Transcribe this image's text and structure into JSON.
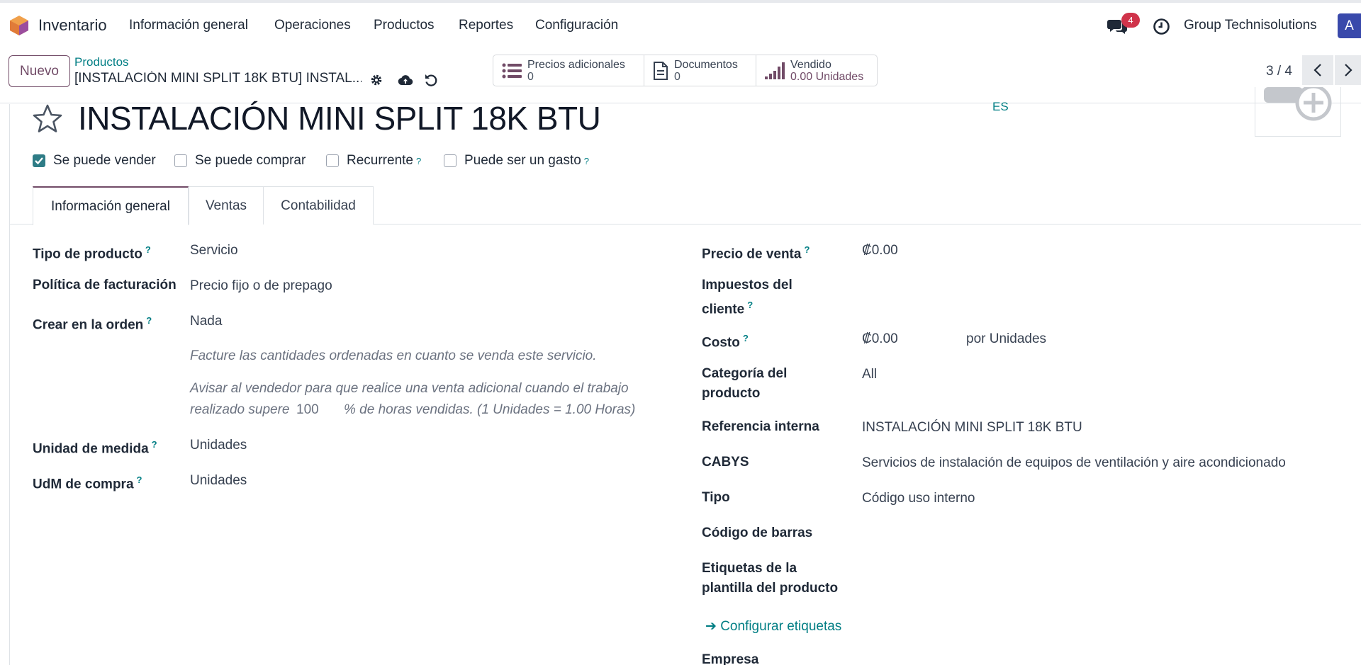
{
  "app": {
    "name": "Inventario"
  },
  "nav": {
    "menus": [
      "Información general",
      "Operaciones",
      "Productos",
      "Reportes",
      "Configuración"
    ],
    "chat_count": "4",
    "company": "Group Technisolutions",
    "avatar_letter": "A"
  },
  "control": {
    "new_label": "Nuevo",
    "breadcrumb_parent": "Productos",
    "breadcrumb_current": "[INSTALACIÓN MINI SPLIT 18K BTU] INSTAL...",
    "smart_buttons": [
      {
        "label": "Precios adicionales",
        "value": "0"
      },
      {
        "label": "Documentos",
        "value": "0"
      },
      {
        "label": "Vendido",
        "value": "0.00 Unidades"
      }
    ],
    "pager": "3 / 4"
  },
  "product": {
    "name": "INSTALACIÓN MINI SPLIT 18K BTU",
    "lang": "ES",
    "checkboxes": [
      {
        "label": "Se puede vender",
        "checked": true,
        "help": ""
      },
      {
        "label": "Se puede comprar",
        "checked": false,
        "help": ""
      },
      {
        "label": "Recurrente",
        "checked": false,
        "help": "?"
      },
      {
        "label": "Puede ser un gasto",
        "checked": false,
        "help": "?"
      }
    ]
  },
  "tabs": [
    "Información general",
    "Ventas",
    "Contabilidad"
  ],
  "left": {
    "tipo_label": "Tipo de producto",
    "tipo_value": "Servicio",
    "politica_label": "Política de facturación",
    "politica_value": "Precio fijo o de prepago",
    "crear_label": "Crear en la orden",
    "crear_value": "Nada",
    "note1": "Facture las cantidades ordenadas en cuanto se venda este servicio.",
    "note2_a": "Avisar al vendedor para que realice una venta adicional cuando el trabajo",
    "note2_b": "realizado supere",
    "note2_num": "100",
    "note2_c": "% de horas vendidas. (1 Unidades = 1.00 Horas)",
    "uom_label": "Unidad de medida",
    "uom_value": "Unidades",
    "uom_po_label": "UdM de compra",
    "uom_po_value": "Unidades",
    "help": "?"
  },
  "right": {
    "precio_label": "Precio de venta",
    "precio_value": "₡0.00",
    "impuestos_label_1": "Impuestos del",
    "impuestos_label_2": "cliente",
    "costo_label": "Costo",
    "costo_value": "₡0.00",
    "costo_unit": "por Unidades",
    "categoria_label_1": "Categoría del",
    "categoria_label_2": "producto",
    "categoria_value": "All",
    "ref_label": "Referencia interna",
    "ref_value": "INSTALACIÓN MINI SPLIT 18K BTU",
    "cabys_label": "CABYS",
    "cabys_value": "Servicios de instalación de equipos de ventilación y aire acondicionado",
    "tipo_label": "Tipo",
    "tipo_value": "Código uso interno",
    "barcode_label": "Código de barras",
    "etiquetas_label_1": "Etiquetas de la",
    "etiquetas_label_2": "plantilla del producto",
    "configurar": "Configurar etiquetas",
    "empresa_label": "Empresa"
  }
}
